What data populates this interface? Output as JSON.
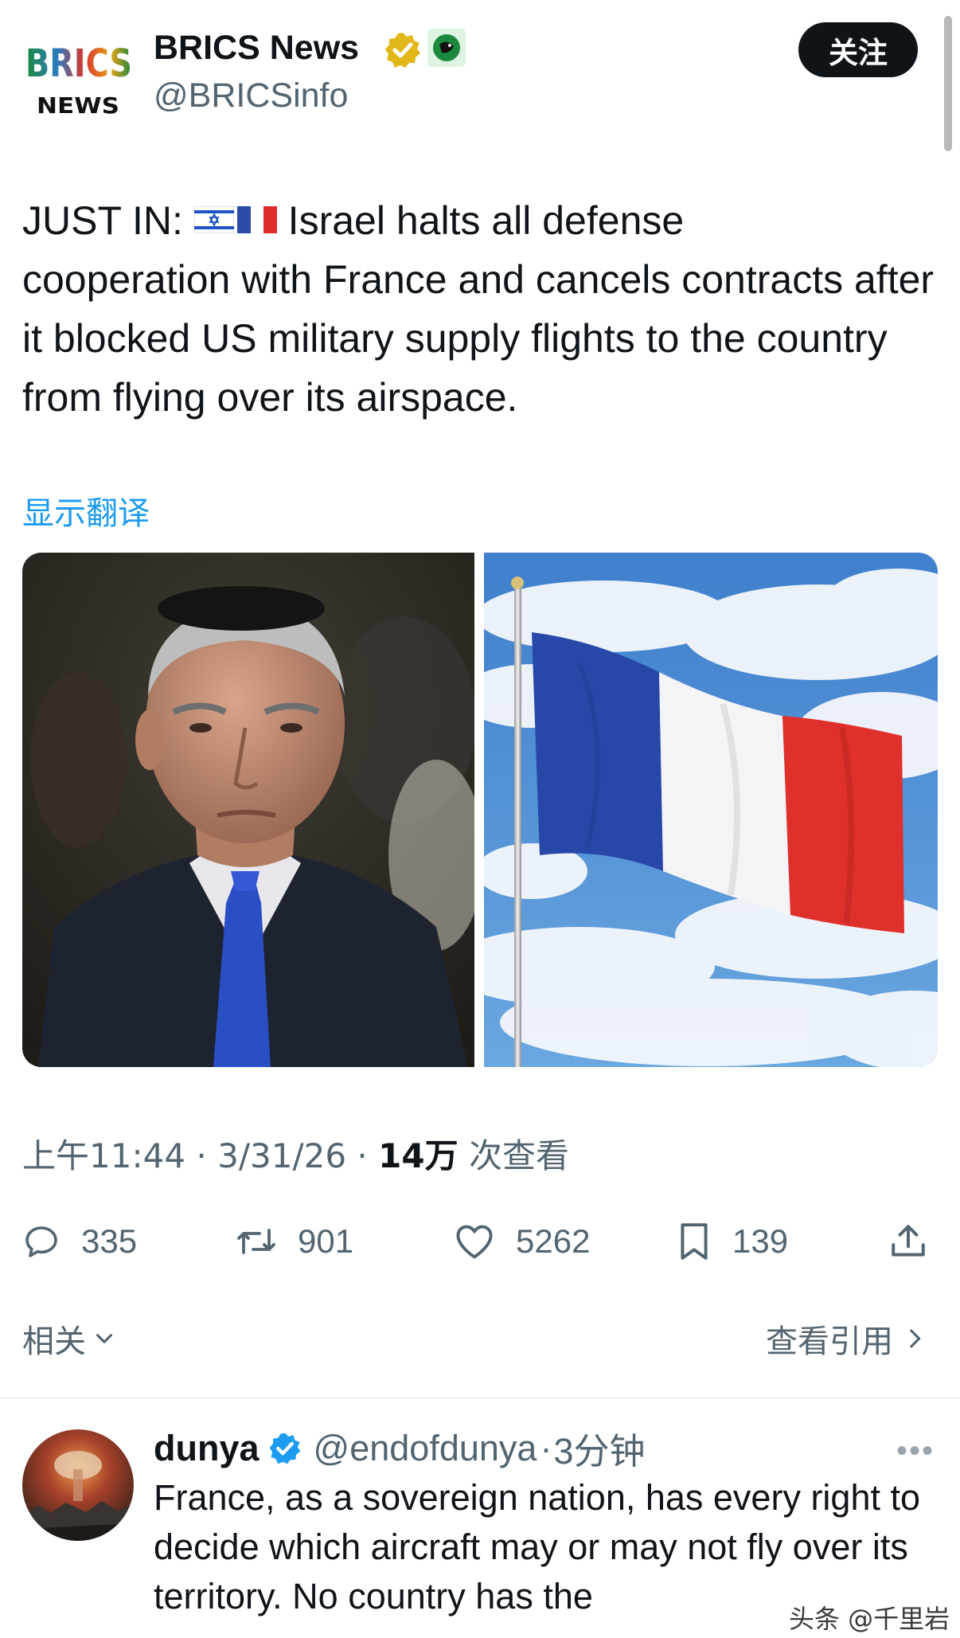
{
  "tweet": {
    "account": {
      "logo_text_top": "BRICS",
      "logo_text_bottom": "NEWS",
      "display_name": "BRICS News",
      "handle": "@BRICSinfo"
    },
    "follow_label": "关注",
    "text_prefix": "JUST IN: ",
    "text_line1_rest": " Israel halts all defense",
    "text_rest": "cooperation with France and cancels contracts after it blocked US military supply flights to the country from flying over its airspace.",
    "translate_label": "显示翻译",
    "meta": {
      "time": "上午11:44",
      "date": "3/31/26",
      "views_count": "14万",
      "views_label": "次查看"
    },
    "actions": {
      "replies": "335",
      "retweets": "901",
      "likes": "5262",
      "bookmarks": "139"
    },
    "related_label": "相关",
    "quotes_label": "查看引用"
  },
  "reply": {
    "name": "dunya",
    "handle": "@endofdunya",
    "time": "3分钟",
    "text": "France, as a sovereign nation, has every right to decide which aircraft may or may not fly over its territory. No country has the"
  },
  "watermark": "头条 @千里岩",
  "colors": {
    "accent_blue": "#1d9bf0",
    "text_primary": "#0f1419",
    "text_secondary": "#536471",
    "follow_bg": "#0f1419"
  }
}
